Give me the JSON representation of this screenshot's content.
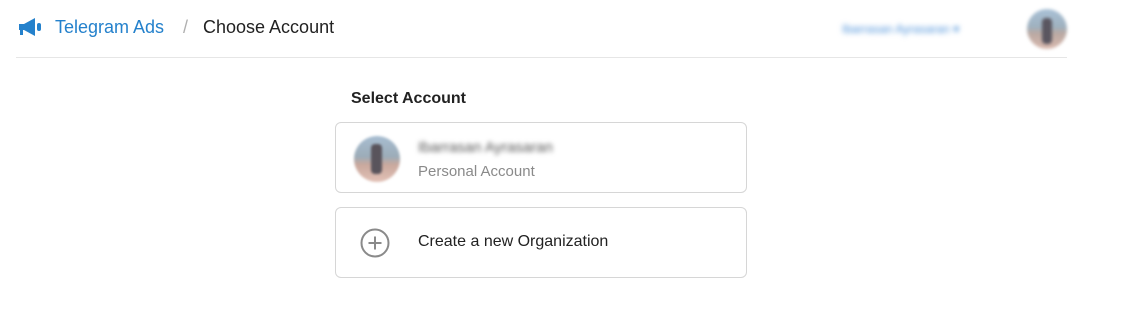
{
  "header": {
    "brand": "Telegram Ads",
    "separator": "/",
    "title": "Choose Account",
    "user_name": "Ibarrasan Ayrasaran",
    "user_menu_caret": "▾",
    "logo_icon": "megaphone-icon",
    "avatar_icon": "user-avatar"
  },
  "main": {
    "section_title": "Select Account",
    "accounts": [
      {
        "name": "Ibarrasan Ayrasaran",
        "type": "Personal Account"
      }
    ],
    "create": {
      "label": "Create a new Organization",
      "icon": "plus-circle-icon"
    }
  },
  "colors": {
    "brand": "#2481cc",
    "border": "#d6d6d6",
    "muted_text": "#8a8a8a",
    "plus_icon": "#8a8a8a"
  }
}
